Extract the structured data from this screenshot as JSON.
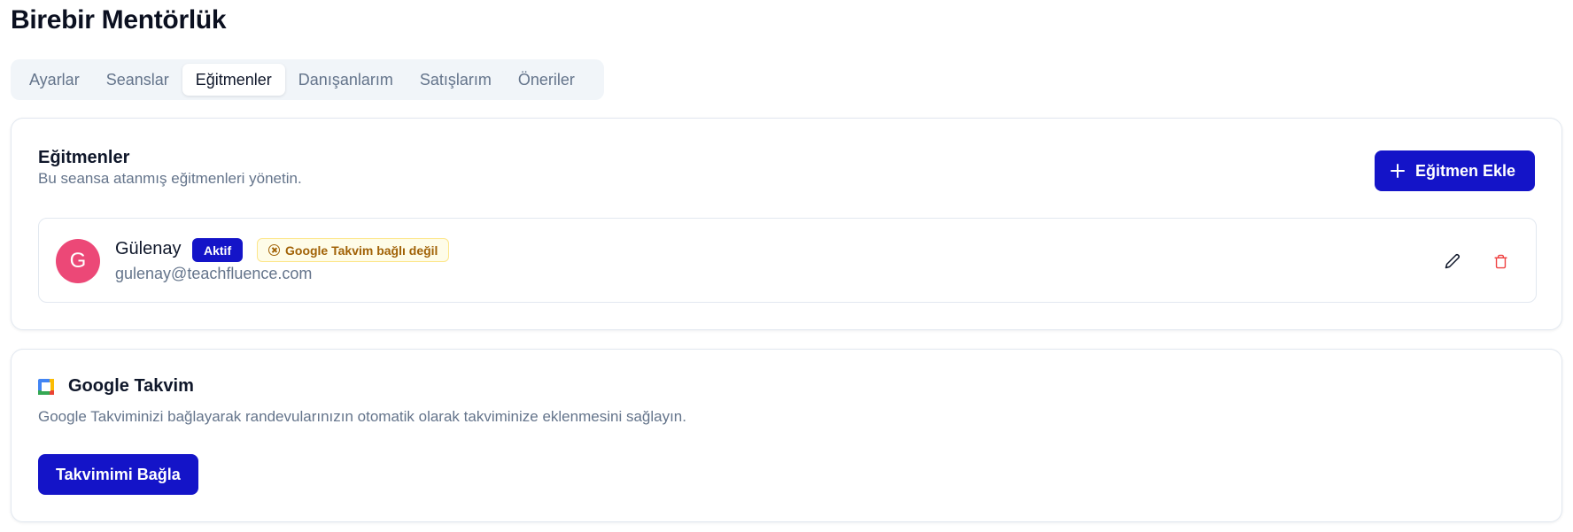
{
  "page": {
    "title": "Birebir Mentörlük"
  },
  "tabs": [
    {
      "label": "Ayarlar"
    },
    {
      "label": "Seanslar"
    },
    {
      "label": "Eğitmenler",
      "active": true
    },
    {
      "label": "Danışanlarım"
    },
    {
      "label": "Satışlarım"
    },
    {
      "label": "Öneriler"
    }
  ],
  "instructors_section": {
    "title": "Eğitmenler",
    "description": "Bu seansa atanmış eğitmenleri yönetin.",
    "add_button_label": "Eğitmen Ekle",
    "add_button_icon": "plus-icon"
  },
  "instructors": [
    {
      "avatar_letter": "G",
      "avatar_color": "#ec4877",
      "name": "Gülenay",
      "status_badge": "Aktif",
      "calendar_badge": "Google Takvim bağlı değil",
      "calendar_badge_icon": "x-circle-icon",
      "email": "gulenay@teachfluence.com",
      "edit_icon": "pencil-icon",
      "delete_icon": "trash-icon"
    }
  ],
  "calendar_section": {
    "icon": "google-calendar-icon",
    "title": "Google Takvim",
    "description": "Google Takviminizi bağlayarak randevularınızın otomatik olarak takviminize eklenmesini sağlayın.",
    "connect_button_label": "Takvimimi Bağla"
  },
  "colors": {
    "primary": "#1414c8",
    "avatar": "#ec4877",
    "danger": "#ef4444",
    "warning_text": "#a16207",
    "warning_bg": "#fefce8",
    "muted_text": "#64748b"
  }
}
